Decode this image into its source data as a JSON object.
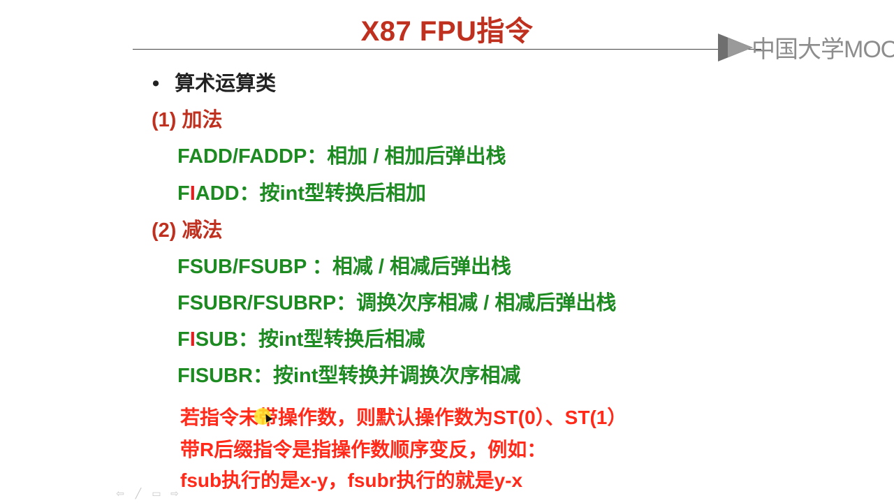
{
  "slide": {
    "title": "X87 FPU指令",
    "bullet": "算术运算类",
    "sections": [
      {
        "heading": "(1) 加法",
        "items": [
          {
            "pre": "FADD/FADDP：",
            "text": "相加 / 相加后弹出栈"
          },
          {
            "pre": "F",
            "hl": "I",
            "post": "ADD：",
            "text": "按int型转换后相加"
          }
        ]
      },
      {
        "heading": "(2) 减法",
        "items": [
          {
            "pre": "FSUB/FSUBP ：",
            "text": "相减 / 相减后弹出栈"
          },
          {
            "pre": "FSUBR/FSUBRP：",
            "text": "调换次序相减 / 相减后弹出栈"
          },
          {
            "pre": "F",
            "hl": "I",
            "post": "SUB：",
            "text": "按int型转换后相减"
          },
          {
            "pre": "FISUBR：",
            "text": "按int型转换并调换次序相减"
          }
        ]
      }
    ],
    "notes": [
      "若指令未带操作数，则默认操作数为ST(0）、ST(1）",
      "带R后缀指令是指操作数顺序变反，例如：",
      "fsub执行的是x-y，fsubr执行的就是y-x"
    ]
  },
  "logo": {
    "text": "中国大学MOOC",
    "icon": "mooc-logo-icon",
    "color": "#8d8d8d"
  },
  "nav": {
    "prev": "⇦",
    "pen": "╱",
    "menu": "▭",
    "next": "⇨"
  },
  "colors": {
    "title": "#c0301f",
    "heading": "#c0301f",
    "instruction": "#1d8a22",
    "note": "#ff2a1a"
  }
}
